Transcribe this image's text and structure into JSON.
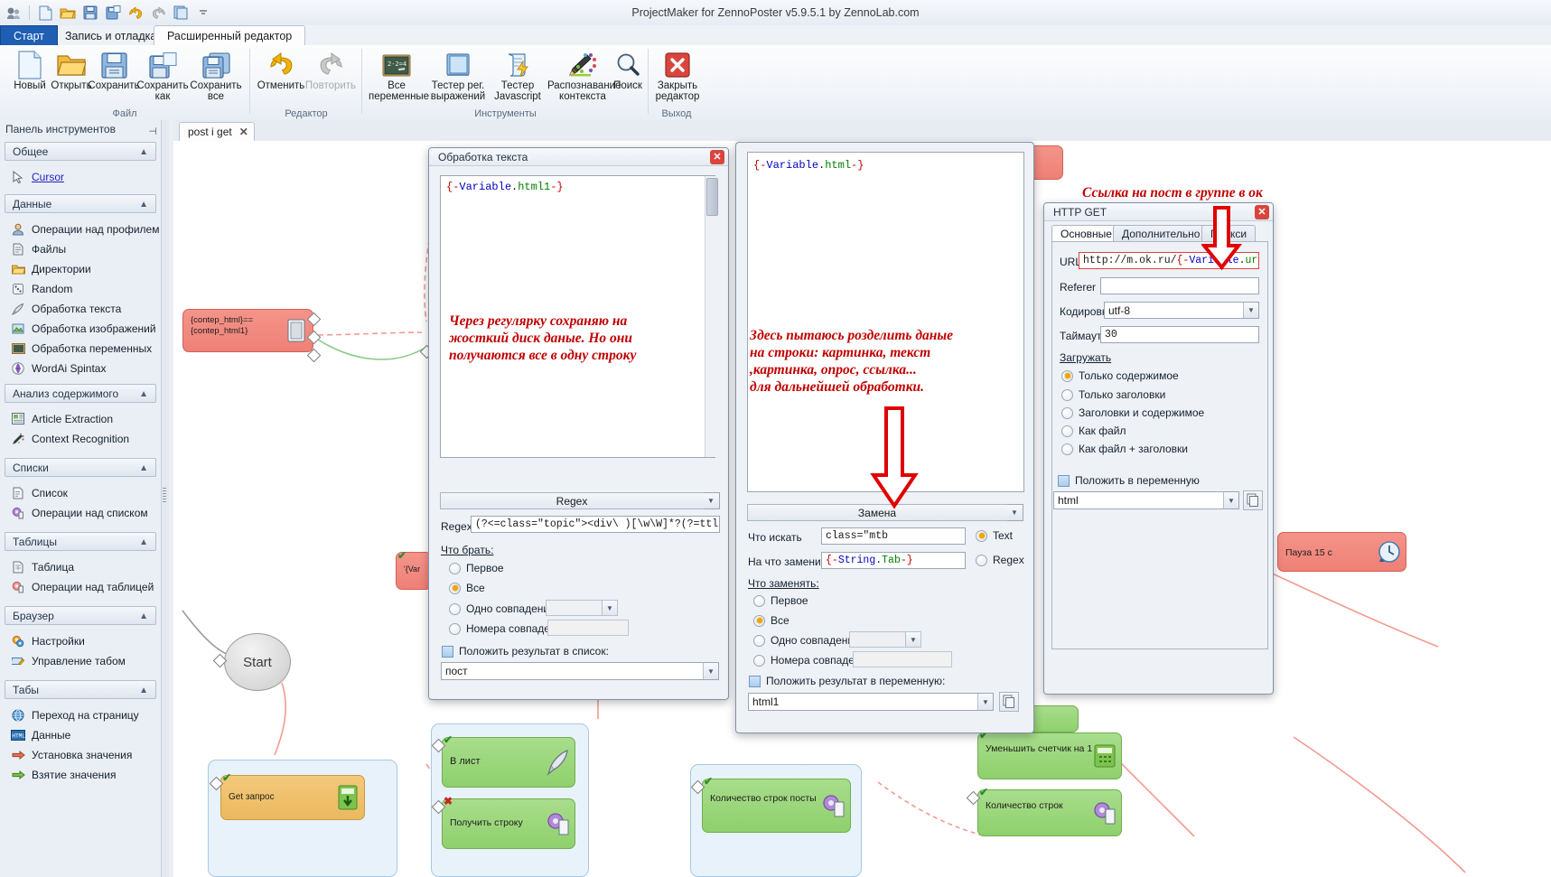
{
  "app": {
    "title": "ProjectMaker for ZennoPoster v5.9.5.1 by ZennoLab.com"
  },
  "quick_access": {
    "icons": [
      "project-icon",
      "new-icon",
      "open-icon",
      "save-icon",
      "save-as-icon",
      "undo-icon",
      "redo-icon",
      "copy-icon",
      "customize-icon"
    ]
  },
  "ribbon": {
    "tabs": [
      {
        "label": "Старт",
        "active": false
      },
      {
        "label": "Запись и отладка",
        "active": false
      },
      {
        "label": "Расширенный редактор",
        "active": true
      }
    ],
    "groups": [
      {
        "label": "Файл",
        "buttons": [
          {
            "label": "Новый",
            "icon": "new-document-icon",
            "disabled": false
          },
          {
            "label": "Открыть",
            "icon": "open-folder-icon",
            "disabled": false
          },
          {
            "label": "Сохранить",
            "icon": "save-floppy-icon",
            "disabled": false
          },
          {
            "label": "Сохранить как",
            "icon": "save-as-icon",
            "disabled": false
          },
          {
            "label": "Сохранить все",
            "icon": "save-all-icon",
            "disabled": false
          }
        ]
      },
      {
        "label": "Редактор",
        "buttons": [
          {
            "label": "Отменить",
            "icon": "undo-arrow-icon",
            "disabled": false
          },
          {
            "label": "Повторить",
            "icon": "redo-arrow-icon",
            "disabled": true
          }
        ]
      },
      {
        "label": "Инструменты",
        "buttons": [
          {
            "label": "Все переменные",
            "icon": "blackboard-icon",
            "disabled": false
          },
          {
            "label": "Тестер рег. выражений",
            "icon": "blue-book-icon",
            "disabled": false
          },
          {
            "label": "Тестер Javascript",
            "icon": "script-lightning-icon",
            "disabled": false
          },
          {
            "label": "Распознавание контекста",
            "icon": "pencil-palette-icon",
            "disabled": false
          },
          {
            "label": "Поиск",
            "icon": "magnifier-icon",
            "disabled": false
          }
        ]
      },
      {
        "label": "Выход",
        "buttons": [
          {
            "label": "Закрыть редактор",
            "icon": "red-cross-icon",
            "disabled": false
          }
        ]
      }
    ]
  },
  "toolbox": {
    "header": "Панель инструментов",
    "pin_icon": "pin-icon",
    "close_icon": "close-icon",
    "groups": [
      {
        "title": "Общее",
        "items": [
          {
            "label": "Cursor",
            "icon": "cursor-arrow-icon",
            "link": true
          }
        ]
      },
      {
        "title": "Данные",
        "items": [
          {
            "label": "Операции над профилем",
            "icon": "profile-person-icon"
          },
          {
            "label": "Файлы",
            "icon": "file-page-icon"
          },
          {
            "label": "Директории",
            "icon": "folder-icon"
          },
          {
            "label": "Random",
            "icon": "dice-icon"
          },
          {
            "label": "Обработка текста",
            "icon": "quill-pen-icon"
          },
          {
            "label": "Обработка изображений",
            "icon": "image-picture-icon"
          },
          {
            "label": "Обработка переменных",
            "icon": "blackboard-icon"
          },
          {
            "label": "WordAi Spintax",
            "icon": "wordai-icon"
          }
        ]
      },
      {
        "title": "Анализ содержимого",
        "items": [
          {
            "label": "Article Extraction",
            "icon": "article-icon"
          },
          {
            "label": "Context Recognition",
            "icon": "context-brush-icon"
          }
        ]
      },
      {
        "title": "Списки",
        "items": [
          {
            "label": "Список",
            "icon": "list-icon"
          },
          {
            "label": "Операции над списком",
            "icon": "list-gear-icon"
          }
        ]
      },
      {
        "title": "Таблицы",
        "items": [
          {
            "label": "Таблица",
            "icon": "table-icon"
          },
          {
            "label": "Операции над таблицей",
            "icon": "table-gear-icon"
          }
        ]
      },
      {
        "title": "Браузер",
        "items": [
          {
            "label": "Настройки",
            "icon": "settings-gear-icon"
          },
          {
            "label": "Управление табом",
            "icon": "tab-edit-icon"
          }
        ]
      },
      {
        "title": "Табы",
        "items": [
          {
            "label": "Переход на страницу",
            "icon": "globe-icon"
          },
          {
            "label": "Данные",
            "icon": "html-icon"
          },
          {
            "label": "Установка значения",
            "icon": "set-value-icon"
          },
          {
            "label": "Взятие значения",
            "icon": "get-value-icon"
          }
        ]
      }
    ]
  },
  "document_tab": {
    "label": "post i get",
    "close_icon": "close-icon"
  },
  "canvas": {
    "start_node": {
      "label": "Start"
    },
    "nodes": [
      {
        "name": "contep-html-node",
        "label": "{contep_html}==\n{contep_html1}",
        "color": "red",
        "icon": "variable-icon"
      },
      {
        "name": "variable-node-small",
        "label": "'{Var",
        "color": "red",
        "icon": ""
      },
      {
        "name": "pause-node",
        "label": "Пауза 15 с",
        "color": "red",
        "icon": "clock-icon"
      },
      {
        "name": "get-request-node",
        "label": "Get запрос",
        "color": "orange",
        "icon": "download-icon"
      },
      {
        "name": "v-list-node",
        "label": "В лист",
        "color": "green",
        "icon": "quill-pen-icon"
      },
      {
        "name": "get-string-node",
        "label": "Получить строку",
        "color": "green",
        "icon": "list-gear-icon"
      },
      {
        "name": "count-rows-posts-node",
        "label": "Количество строк посты",
        "color": "green",
        "icon": "list-gear-icon"
      },
      {
        "name": "decrement-counter-node",
        "label": "Уменьшить счетчик на 1",
        "color": "green",
        "icon": "calc-icon"
      },
      {
        "name": "count-rows-node-2",
        "label": "Количество строк",
        "color": "green",
        "icon": "list-gear-icon"
      }
    ]
  },
  "annotations": [
    {
      "name": "annotation-regex-save",
      "text": "Через регулярку сохраняю на\nжосткий диск даные. Но они\nполучаются все в одну строку"
    },
    {
      "name": "annotation-split-data",
      "text": "Здесь пытаюсь розделить даные\nна строки: картинка, текст\n,картинка, опрос, ссылка...\nдля дальнейшей обработки."
    },
    {
      "name": "annotation-post-link",
      "text": "Ссылка на пост в группе в ок"
    }
  ],
  "text_dialog": {
    "title": "Обработка текста",
    "close_icon": "close-icon",
    "input_text": "{-Variable.html1-}",
    "mode_button": "Regex",
    "regex_label": "Regex",
    "regex_value": "(?<=class=\"topic\"><div\\ )[\\w\\W]*?(?=ttl\">К",
    "what_to_take_label": "Что брать:",
    "options": [
      {
        "label": "Первое",
        "selected": false
      },
      {
        "label": "Все",
        "selected": true
      },
      {
        "label": "Одно совпадение",
        "selected": false,
        "has_combo": true,
        "combo_value": ""
      },
      {
        "label": "Номера совпадений",
        "selected": false,
        "has_input": true,
        "input_value": ""
      }
    ],
    "result_checkbox": "Положить результат в список:",
    "result_value": "пост"
  },
  "replace_dialog": {
    "input_text": "{-Variable.html-}",
    "mode_button": "Замена",
    "search_label": "Что искать",
    "search_value": "class=\"mtb",
    "replace_label": "На что заменить",
    "replace_value": "{-String.Tab-}",
    "type_text": "Text",
    "type_regex": "Regex",
    "type_selected": "Text",
    "what_to_replace_label": "Что заменять:",
    "options": [
      {
        "label": "Первое",
        "selected": false
      },
      {
        "label": "Все",
        "selected": true
      },
      {
        "label": "Одно совпадение",
        "selected": false,
        "has_combo": true,
        "combo_value": ""
      },
      {
        "label": "Номера совпадений",
        "selected": false,
        "has_input": true,
        "input_value": ""
      }
    ],
    "result_checkbox": "Положить результат в переменную:",
    "result_value": "html1",
    "copy_icon": "copy-icon"
  },
  "http_dialog": {
    "title": "HTTP GET",
    "close_icon": "close-icon",
    "tabs": [
      {
        "label": "Основные",
        "active": true
      },
      {
        "label": "Дополнительно",
        "active": false
      },
      {
        "label": "Прокси",
        "active": false
      }
    ],
    "fields": [
      {
        "label": "URL",
        "value": "http://m.ok.ru/{-Variable.url-}"
      },
      {
        "label": "Referer",
        "value": ""
      },
      {
        "label": "Кодировка",
        "value": "utf-8",
        "combo": true
      },
      {
        "label": "Таймаут",
        "value": "30"
      }
    ],
    "load_label": "Загружать",
    "load_options": [
      {
        "label": "Только содержимое",
        "selected": true
      },
      {
        "label": "Только заголовки",
        "selected": false
      },
      {
        "label": "Заголовки и содержимое",
        "selected": false
      },
      {
        "label": "Как файл",
        "selected": false
      },
      {
        "label": "Как файл + заголовки",
        "selected": false
      }
    ],
    "result_checkbox": "Положить в переменную",
    "result_value": "html",
    "copy_icon": "copy-icon"
  },
  "colors": {
    "accent_blue": "#1e5fb4",
    "annotation_red": "#c00000",
    "node_red": "#ef8076",
    "node_green": "#8fd06c",
    "node_orange": "#eab95f",
    "radio_amber": "#f0a500"
  }
}
